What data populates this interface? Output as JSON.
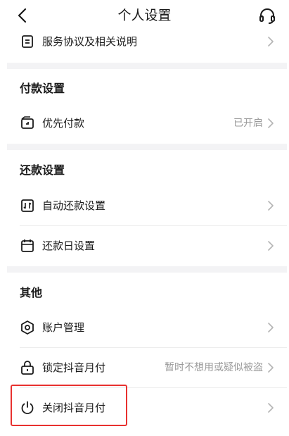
{
  "header": {
    "title": "个人设置",
    "back_icon": "chevron-left-icon",
    "support_icon": "headset-icon"
  },
  "rows": {
    "service_agreement": {
      "label": "服务协议及相关说明",
      "icon": "document-icon"
    },
    "priority_payment": {
      "label": "优先付款",
      "value": "已开启",
      "icon": "wallet-icon"
    },
    "auto_repay": {
      "label": "自动还款设置",
      "icon": "auto-repay-icon"
    },
    "repay_date": {
      "label": "还款日设置",
      "icon": "calendar-icon"
    },
    "account_manage": {
      "label": "账户管理",
      "icon": "shield-settings-icon"
    },
    "lock": {
      "label": "锁定抖音月付",
      "value": "暂时不想用或疑似被盗",
      "icon": "lock-icon"
    },
    "close": {
      "label": "关闭抖音月付",
      "icon": "power-icon"
    }
  },
  "sections": {
    "payment": "付款设置",
    "repayment": "还款设置",
    "other": "其他"
  },
  "colors": {
    "highlight": "#e8312f",
    "secondary_text": "#9a9a9a",
    "gap": "#f3f3f5"
  }
}
